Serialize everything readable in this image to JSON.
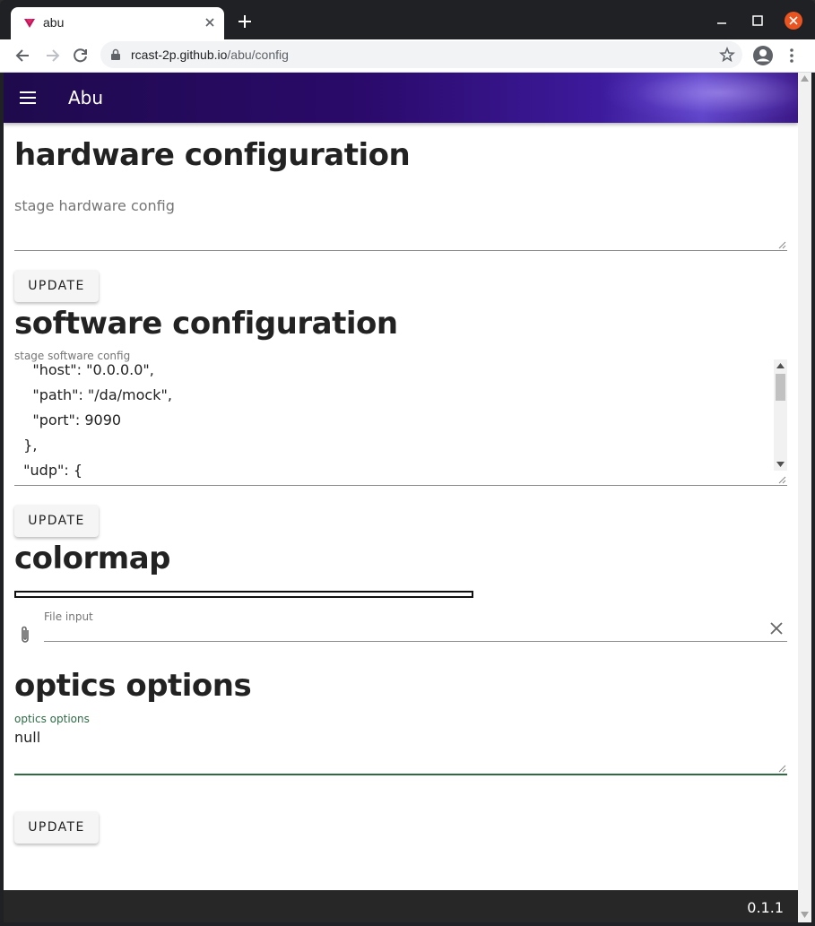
{
  "browser": {
    "tab_title": "abu",
    "url_host": "rcast-2p.github.io",
    "url_path": "/abu/config"
  },
  "app": {
    "title": "Abu"
  },
  "hardware": {
    "heading": "hardware configuration",
    "placeholder": "stage hardware config",
    "button": "UPDATE"
  },
  "software": {
    "heading": "software configuration",
    "label": "stage software config",
    "lines": [
      "    \"host\": \"0.0.0.0\",",
      "    \"path\": \"/da/mock\",",
      "    \"port\": 9090",
      "  },",
      "  \"udp\": {"
    ],
    "button": "UPDATE"
  },
  "colormap": {
    "heading": "colormap",
    "file_label": "File input"
  },
  "optics": {
    "heading": "optics options",
    "label": "optics options",
    "value": "null",
    "button": "UPDATE"
  },
  "footer": {
    "version": "0.1.1"
  },
  "colors": {
    "appbar": "#2a0a6a",
    "focus_green": "#2e6b45",
    "footer": "#272727",
    "close_button": "#e95420"
  }
}
